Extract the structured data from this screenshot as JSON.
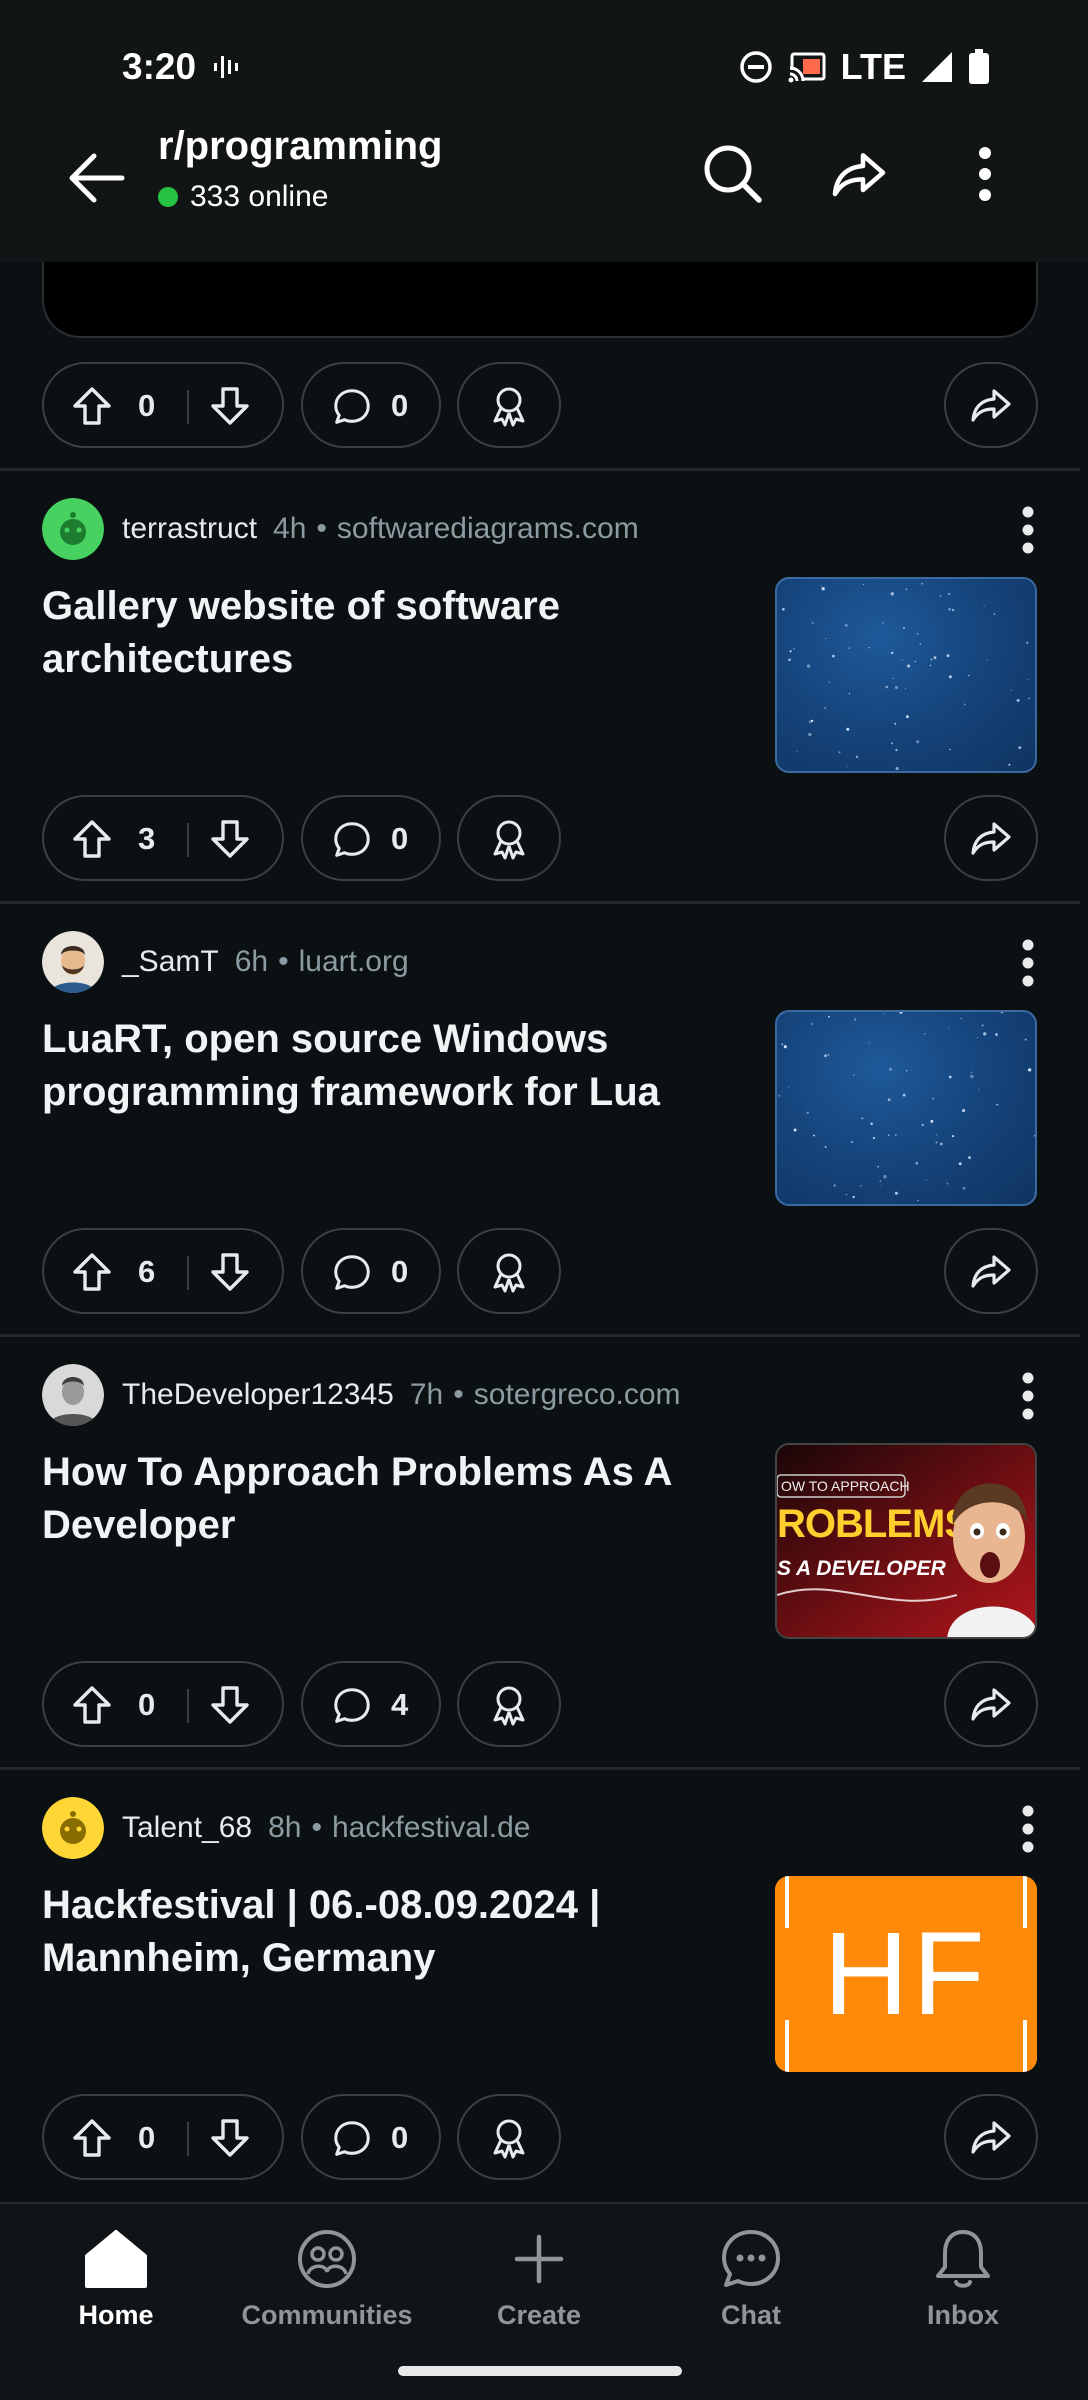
{
  "status_bar": {
    "time": "3:20",
    "network": "LTE",
    "icons": [
      "voice-activity-icon",
      "do-not-disturb-icon",
      "cast-icon",
      "signal-icon",
      "battery-icon"
    ]
  },
  "header": {
    "title": "r/programming",
    "online": "333 online",
    "icons": [
      "back-arrow-icon",
      "search-icon",
      "share-icon",
      "more-vert-icon"
    ]
  },
  "first_post": {
    "upvotes": "0",
    "comments": "0"
  },
  "posts": [
    {
      "username": "terrastruct",
      "age": "4h",
      "domain": "softwarediagrams.com",
      "title": "Gallery website of software architectures",
      "upvotes": "3",
      "comments": "0",
      "thumbnail": "starfield"
    },
    {
      "username": "_SamT",
      "age": "6h",
      "domain": "luart.org",
      "title": "LuaRT, open source Windows programming framework for Lua",
      "upvotes": "6",
      "comments": "0",
      "thumbnail": "starfield"
    },
    {
      "username": "TheDeveloper12345",
      "age": "7h",
      "domain": "sotergreco.com",
      "title": "How To Approach Problems As A Developer",
      "upvotes": "0",
      "comments": "4",
      "thumbnail": "video-thumbnail",
      "thumbnail_text": [
        "OW TO APPROACH",
        "ROBLEMS",
        "S A DEVELOPER"
      ]
    },
    {
      "username": "Talent_68",
      "age": "8h",
      "domain": "hackfestival.de",
      "title": "Hackfestival | 06.-08.09.2024 | Mannheim, Germany",
      "upvotes": "0",
      "comments": "0",
      "thumbnail": "hf-logo",
      "thumbnail_text": [
        "HF"
      ]
    }
  ],
  "meta_separator": "•",
  "bottom_nav": [
    {
      "label": "Home",
      "icon": "home-icon",
      "active": true
    },
    {
      "label": "Communities",
      "icon": "communities-icon",
      "active": false
    },
    {
      "label": "Create",
      "icon": "plus-icon",
      "active": false
    },
    {
      "label": "Chat",
      "icon": "chat-icon",
      "active": false
    },
    {
      "label": "Inbox",
      "icon": "bell-icon",
      "active": false
    }
  ],
  "colors": {
    "background": "#0b1013",
    "online_dot": "#25c244",
    "hf_orange": "#ff8a0a",
    "meta_text": "#8c9aa2"
  }
}
